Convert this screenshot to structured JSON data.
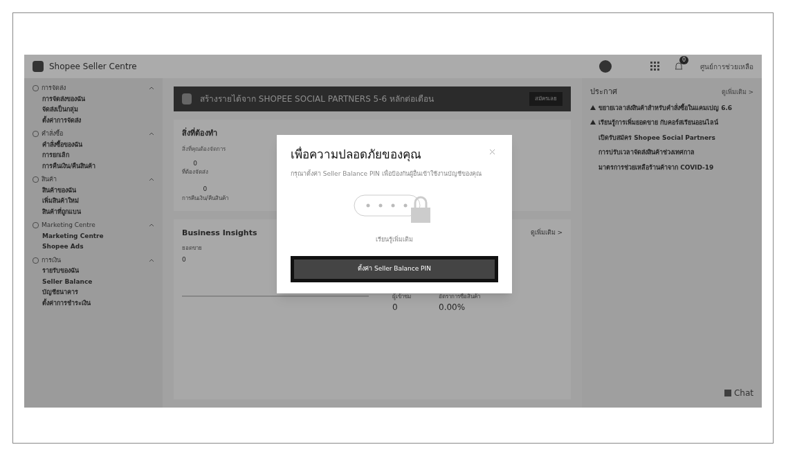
{
  "header": {
    "logo_text": "Shopee Seller Centre",
    "help": "ศูนย์การช่วยเหลือ",
    "notification_badge": "0"
  },
  "sidebar": [
    {
      "title": "การจัดส่ง",
      "expanded": true,
      "items": [
        "การจัดส่งของฉัน",
        "จัดส่งเป็นกลุ่ม",
        "ตั้งค่าการจัดส่ง"
      ]
    },
    {
      "title": "คำสั่งซื้อ",
      "expanded": true,
      "items": [
        "คำสั่งซื้อของฉัน",
        "การยกเลิก",
        "การคืนเงิน/คืนสินค้า"
      ]
    },
    {
      "title": "สินค้า",
      "expanded": true,
      "items": [
        "สินค้าของฉัน",
        "เพิ่มสินค้าใหม่",
        "สินค้าที่ถูกแบน"
      ]
    },
    {
      "title": "Marketing Centre",
      "expanded": true,
      "items": [
        "Marketing Centre",
        "Shopee Ads"
      ]
    },
    {
      "title": "การเงิน",
      "expanded": true,
      "items": [
        "รายรับของฉัน",
        "Seller Balance",
        "บัญชีธนาคาร",
        "ตั้งค่าการชำระเงิน"
      ]
    }
  ],
  "banner": {
    "text": "สร้างรายได้จาก SHOPEE SOCIAL PARTNERS 5-6 หลักต่อเดือน",
    "button": "สมัครเลย"
  },
  "todo": {
    "title": "สิ่งที่ต้องทำ",
    "subtitle": "สิ่งที่คุณต้องจัดการ",
    "stats": [
      {
        "value": "0",
        "label": "ที่ต้องจัดส่ง"
      },
      {
        "value": "0",
        "label": "การคืนเงิน/คืนสินค้า"
      }
    ]
  },
  "insights": {
    "title": "Business Insights",
    "more": "ดูเพิ่มเติม >",
    "metric": "ยอดขาย",
    "value": "0",
    "stats": [
      {
        "label": "ผู้เข้าชม",
        "value": "0"
      },
      {
        "label": "อัตราการซื้อสินค้า",
        "value": "0.00%"
      }
    ]
  },
  "announcements": {
    "title": "ประกาศ",
    "more": "ดูเพิ่มเติม >",
    "items": [
      {
        "title": "ขยายเวลาส่งสินค้าสำหรับคำสั่งซื้อในแคมเปญ 6.6",
        "pinned": true
      },
      {
        "title": "เรียนรู้การเพิ่มยอดขาย กับคอร์สเรียนออนไลน์",
        "pinned": true
      },
      {
        "title": "เปิดรับสมัคร Shopee Social Partners",
        "pinned": false
      },
      {
        "title": "การปรับเวลาจัดส่งสินค้าช่วงเทศกาล",
        "pinned": false
      },
      {
        "title": "มาตรการช่วยเหลือร้านค้าจาก COVID-19",
        "pinned": false
      }
    ]
  },
  "chat": "Chat",
  "modal": {
    "title": "เพื่อความปลอดภัยของคุณ",
    "description": "กรุณาตั้งค่า Seller Balance PIN เพื่อป้องกันผู้อื่นเข้าใช้งานบัญชีของคุณ",
    "link": "เรียนรู้เพิ่มเติม",
    "button": "ตั้งค่า Seller Balance PIN"
  }
}
